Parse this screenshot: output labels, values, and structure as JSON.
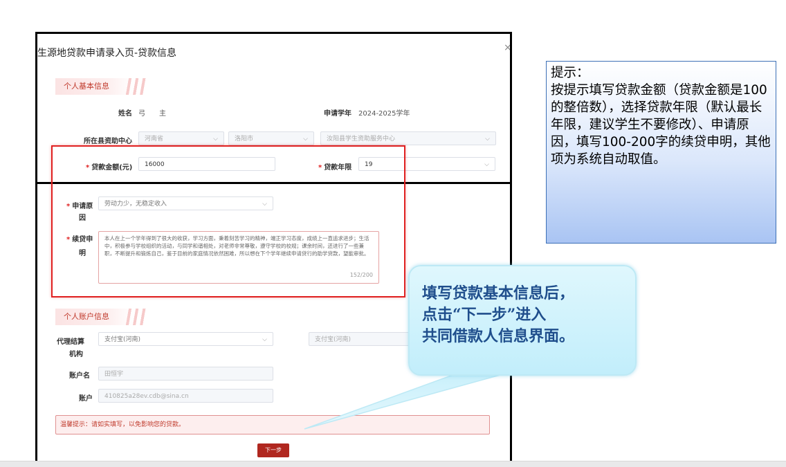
{
  "dialog": {
    "title": "生源地贷款申请录入页-贷款信息",
    "close": "×",
    "section_personal": "个人基本信息",
    "name_label": "姓名",
    "name_value": "弓　　主",
    "year_label": "申请学年",
    "year_value": "2024-2025学年",
    "center_label": "所在县资助中心",
    "province": "河南省",
    "city": "洛阳市",
    "center": "汝阳县学生资助服务中心",
    "amount_label": "贷款金额(元)",
    "amount_value": "16000",
    "term_label": "贷款年限",
    "term_value": "19",
    "reason_label_1": "申请原",
    "reason_label_2": "因",
    "reason_value": "劳动力少，无稳定收入",
    "statement_label_1": "续贷申",
    "statement_label_2": "明",
    "statement_text": "本人在上一个学年得到了很大的收获，学习方面，秉着刻苦学习的精神，端正学习态度，成绩上一直追求进步；生活中，积极参与学校组织的活动，与同学和谐相处，对老师非常尊敬，遵守学校的校规；课余时间，还进行了一些兼职，不断提升和锻炼自己，鉴于目前的家庭情况依然困难，所以想在下个学年继续申请贷行的助学贷款，望能审批。",
    "statement_count": "152/200",
    "section_account": "个人账户信息",
    "agency_label_1": "代理结算",
    "agency_label_2": "机构",
    "agency_value": "支付宝(河南)",
    "agency_value_2": "支付宝(河南)",
    "account_name_label": "账户名",
    "account_name_value": "田恒宇",
    "account_label": "账户",
    "account_value": "410825a28ev.cdb@sina.cn",
    "warm_tip": "温馨提示：请如实填写，以免影响您的贷款。",
    "next_button": "下一步",
    "required_mark": "*"
  },
  "tip": {
    "line1": "提示：",
    "body": "按提示填写贷款金额（贷款金额是100的整倍数），选择贷款年限（默认最长年限，建议学生不要修改）、申请原因，填写100-200字的续贷申明，其他项为系统自动取值。"
  },
  "callout": {
    "text": "填写贷款基本信息后，\n点击“下一步”进入\n共同借款人信息界面。"
  },
  "colors": {
    "accent_red": "#e02020",
    "button_red": "#b0271f",
    "callout_text": "#1f4e8c",
    "tip_border": "#3b6fb6"
  }
}
